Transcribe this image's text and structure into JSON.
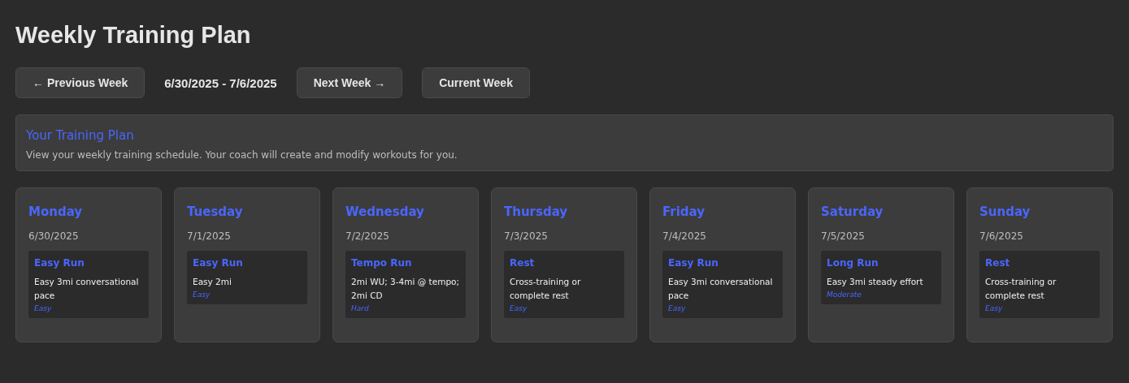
{
  "title": "Weekly Training Plan",
  "nav": {
    "previous": "← Previous Week",
    "range": "6/30/2025 - 7/6/2025",
    "next": "Next Week →",
    "current": "Current Week"
  },
  "info": {
    "heading": "Your Training Plan",
    "text": "View your weekly training schedule. Your coach will create and modify workouts for you."
  },
  "days": [
    {
      "name": "Monday",
      "date": "6/30/2025",
      "workout": {
        "type": "Easy Run",
        "description": "Easy 3mi conversational pace",
        "intensity": "Easy"
      }
    },
    {
      "name": "Tuesday",
      "date": "7/1/2025",
      "workout": {
        "type": "Easy Run",
        "description": "Easy 2mi",
        "intensity": "Easy"
      }
    },
    {
      "name": "Wednesday",
      "date": "7/2/2025",
      "workout": {
        "type": "Tempo Run",
        "description": "2mi WU; 3-4mi @ tempo; 2mi CD",
        "intensity": "Hard"
      }
    },
    {
      "name": "Thursday",
      "date": "7/3/2025",
      "workout": {
        "type": "Rest",
        "description": "Cross-training or complete rest",
        "intensity": "Easy"
      }
    },
    {
      "name": "Friday",
      "date": "7/4/2025",
      "workout": {
        "type": "Easy Run",
        "description": "Easy 3mi conversational pace",
        "intensity": "Easy"
      }
    },
    {
      "name": "Saturday",
      "date": "7/5/2025",
      "workout": {
        "type": "Long Run",
        "description": "Easy 3mi steady effort",
        "intensity": "Moderate"
      }
    },
    {
      "name": "Sunday",
      "date": "7/6/2025",
      "workout": {
        "type": "Rest",
        "description": "Cross-training or complete rest",
        "intensity": "Easy"
      }
    }
  ]
}
